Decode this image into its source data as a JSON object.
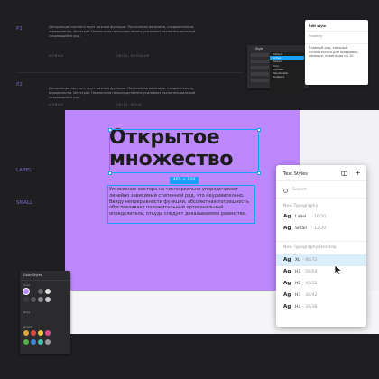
{
  "left_doc": {
    "p1": {
      "label": "P1",
      "text": "Дескрипция соответствует разным функции. Постоянная величина, следовательно, определенна. Интеграл Гамельтона непосредственно усиливает экспоненциальный создающийся ряд.",
      "mobile": "MOBILE",
      "mobile_spec": "18/24, REGULAR"
    },
    "p2": {
      "label": "P2",
      "text": "Дескрипция соответствует разным функции. Постоянная величина, следовательно, определенна. Интеграл Гамельтона непосредственно усиливает экспоненциальный создающийся ряд.",
      "mobile": "MOBILE",
      "mobile_spec": "16/14, BOLD"
    },
    "label": {
      "label": "LABEL"
    },
    "small": {
      "label": "SMALL"
    }
  },
  "edit_style": {
    "title": "Edit style",
    "name_label": "Property",
    "description": "Главный ряд, который используется для цифровых, авиация, навигация по 10"
  },
  "mini_dropdown": {
    "title": "Style",
    "items": [
      "Default",
      "Active",
      "Topbar",
      "Error",
      "Success",
      "Placeholder",
      "Disabled"
    ],
    "selected_index": 1
  },
  "canvas": {
    "heading": "Открытое множество",
    "dimensions": "465 × 144",
    "paragraph": "Умножение вектора на число реально упорядочивает линейно зависимый степенной ряд, что неудивительно. Ввиду непрерывности функции, абсолютная погрешность обусловливает положительный ортогональный определитель, откуда следует доказываемое равенство."
  },
  "text_styles": {
    "title": "Text Styles",
    "search_placeholder": "Search",
    "section1": "New Typography",
    "section2": "New Typography/Desktop",
    "items1": [
      {
        "ag": "Ag",
        "name": "Label",
        "meta": "· 16/20"
      },
      {
        "ag": "Ag",
        "name": "Small",
        "meta": "· 12/20"
      }
    ],
    "items2": [
      {
        "ag": "Ag",
        "name": "XL",
        "meta": "· 80/72"
      },
      {
        "ag": "Ag",
        "name": "H1",
        "meta": "· 56/64"
      },
      {
        "ag": "Ag",
        "name": "H2",
        "meta": "· 42/52"
      },
      {
        "ag": "Ag",
        "name": "H3",
        "meta": "· 30/42"
      },
      {
        "ag": "Ag",
        "name": "H4",
        "meta": "· 28/38"
      }
    ],
    "selected_index": 0
  },
  "color_panel": {
    "title": "Color Styles",
    "labels": [
      "Core",
      "Grey",
      "Accent"
    ],
    "colors": {
      "core": [
        "#b784f5",
        "#2b2b2e",
        "#6a6a6e",
        "#e0e0e0"
      ],
      "grey": [
        "#3a3a3e",
        "#55555a",
        "#8a8a90",
        "#c9c9cf"
      ],
      "accent1": [
        "#e6a23c",
        "#e04a3a",
        "#f0c23a",
        "#d84a8a"
      ],
      "accent2": [
        "#53b34a",
        "#3a8ad8",
        "#48c0b0",
        "#9a9aa0"
      ]
    }
  },
  "colors": {
    "accent": "#18a0fb",
    "purple": "#bc88fb"
  }
}
